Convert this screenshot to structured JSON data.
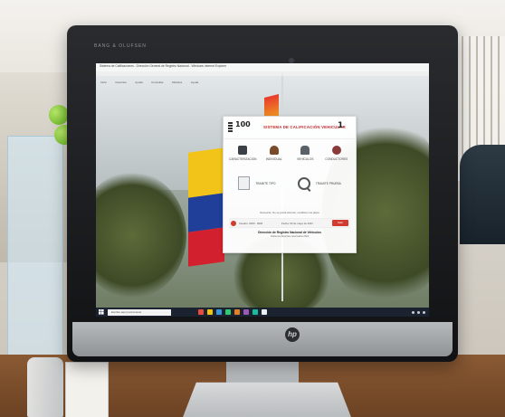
{
  "monitor": {
    "bezel_brand": "BANG & OLUFSEN",
    "chin_logo": "hp"
  },
  "screen": {
    "titlebar_text": "Sistema de Calificaciones - Dirección General de Registro Nacional - Windows Internet Explorer",
    "menu_items": [
      "Inicio",
      "Favoritos",
      "Ayuda",
      "Consultas",
      "Módulos",
      "Ayuda"
    ]
  },
  "dialog": {
    "logo_text": "100",
    "title": "SISTEMA DE CALIFICACIÓN VEHICULAR",
    "badge_text": "1",
    "tiles_row1": [
      {
        "icon": "building-icon",
        "label": "CARACTERIZACION"
      },
      {
        "icon": "person-icon",
        "label": "INDIVIDUAL"
      },
      {
        "icon": "car-icon",
        "label": "VEHÍCULOS"
      },
      {
        "icon": "badge-icon",
        "label": "CONDUCTORES"
      }
    ],
    "tiles_row2": [
      {
        "icon": "document-icon",
        "label": "TRAMITE TIPO"
      },
      {
        "icon": "magnifier-icon",
        "label": "TRAMITE PRUEBA"
      }
    ],
    "note": "Recuerde: No se podrá eliminar, modificar una placa",
    "bar_left": "Usuario: 0000 - 0000",
    "bar_mid": "Fecha: 00 de mayo de 2021",
    "exit_label": "Salir",
    "footer_title": "Dirección de Registro Nacional de Vehículos",
    "footer_line2": "Todos los derechos reservados 2021"
  },
  "taskbar": {
    "search_placeholder": "Escribe aquí para buscar",
    "app_colors": [
      "#e74c3c",
      "#f1c40f",
      "#3498db",
      "#2ecc71",
      "#e67e22",
      "#9b59b6",
      "#1abc9c",
      "#ecf0f1"
    ]
  },
  "colors": {
    "accent_red": "#d23b2f",
    "taskbar": "#1b2330"
  }
}
